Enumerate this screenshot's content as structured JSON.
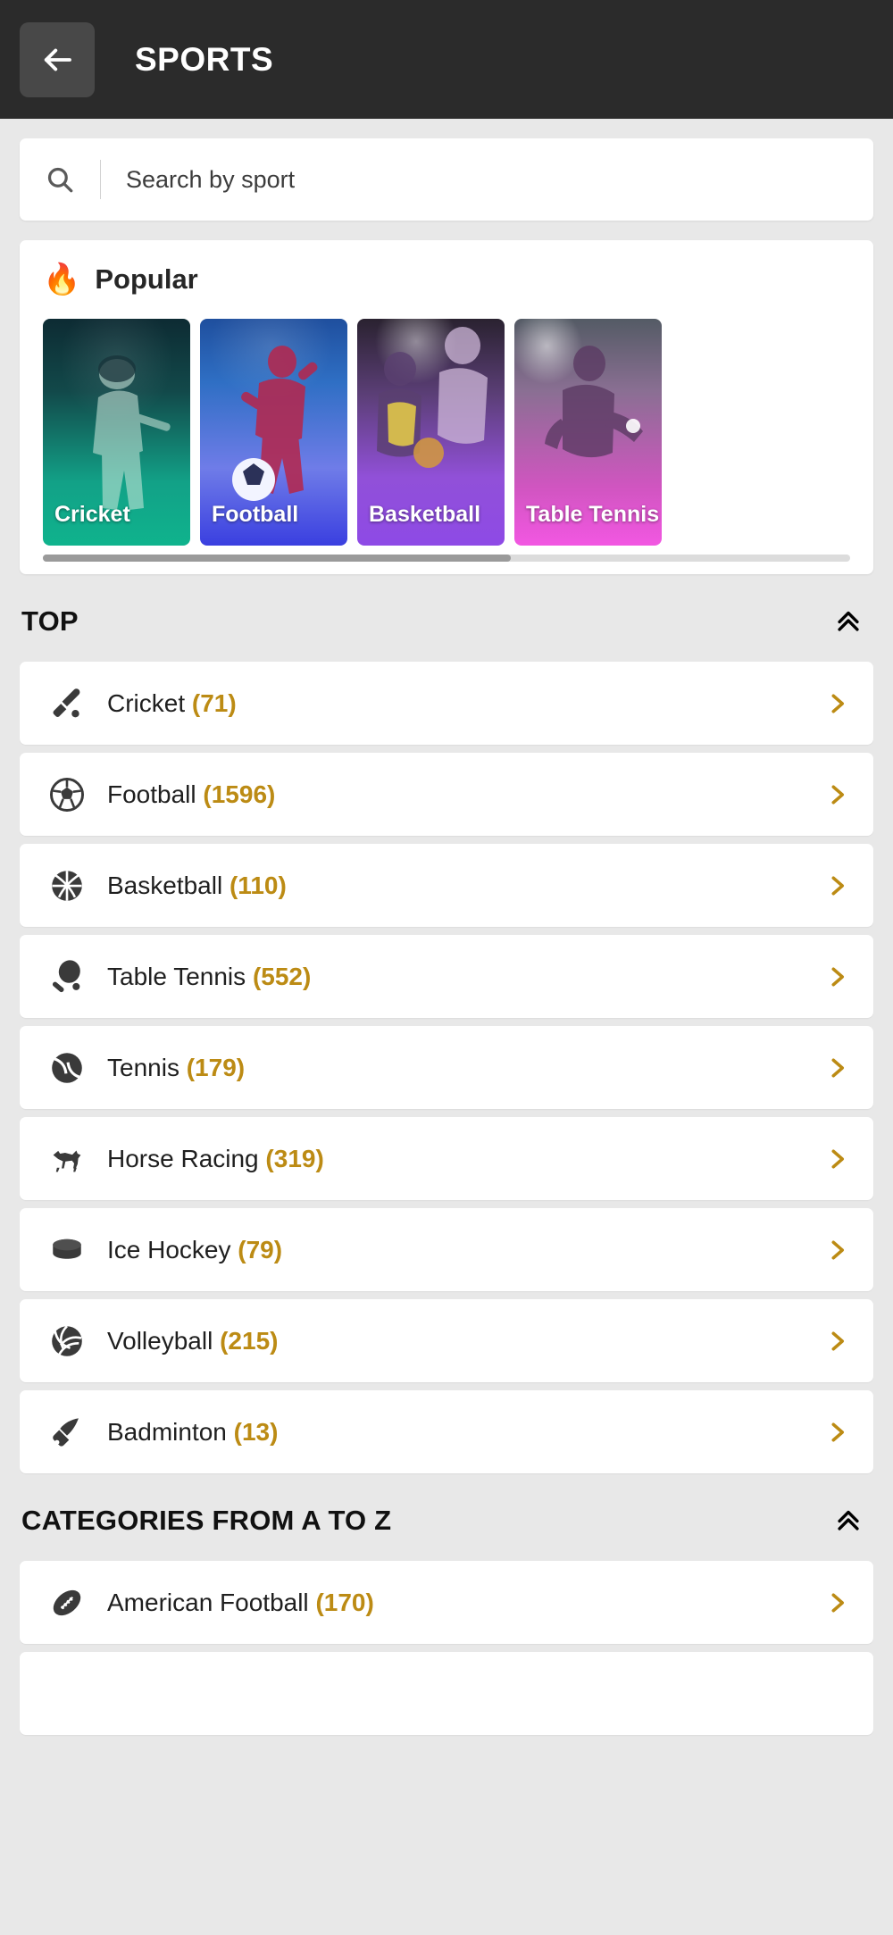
{
  "appbar": {
    "back_icon": "arrow-left-icon",
    "title": "SPORTS"
  },
  "search": {
    "icon": "search-icon",
    "placeholder": "Search by sport",
    "value": ""
  },
  "popular": {
    "icon": "fire-icon",
    "icon_glyph": "🔥",
    "title": "Popular",
    "cards": [
      {
        "label": "Cricket",
        "art": "cricket",
        "accent": "#0fb38d"
      },
      {
        "label": "Football",
        "art": "football",
        "accent": "#3a3fe0"
      },
      {
        "label": "Basketball",
        "art": "basketball",
        "accent": "#8e4ae6"
      },
      {
        "label": "Table Tennis",
        "art": "tabletennis",
        "accent": "#f257e2"
      }
    ]
  },
  "colors": {
    "accent_gold": "#BC8B14",
    "appbar_bg": "#2b2b2b",
    "page_bg": "#e8e8e8",
    "card_bg": "#ffffff",
    "text": "#1f1f1f"
  },
  "sections": [
    {
      "title": "TOP",
      "collapse_icon": "chevron-double-up-icon",
      "items": [
        {
          "name": "Cricket",
          "count": "(71)",
          "icon": "cricket-bat-icon",
          "chevron": "chevron-right-icon"
        },
        {
          "name": "Football",
          "count": "(1596)",
          "icon": "soccer-ball-icon",
          "chevron": "chevron-right-icon"
        },
        {
          "name": "Basketball",
          "count": "(110)",
          "icon": "basketball-icon",
          "chevron": "chevron-right-icon"
        },
        {
          "name": "Table Tennis",
          "count": "(552)",
          "icon": "ping-pong-paddle-icon",
          "chevron": "chevron-right-icon"
        },
        {
          "name": "Tennis",
          "count": "(179)",
          "icon": "tennis-ball-icon",
          "chevron": "chevron-right-icon"
        },
        {
          "name": "Horse Racing",
          "count": "(319)",
          "icon": "horse-icon",
          "chevron": "chevron-right-icon"
        },
        {
          "name": "Ice Hockey",
          "count": "(79)",
          "icon": "hockey-puck-icon",
          "chevron": "chevron-right-icon"
        },
        {
          "name": "Volleyball",
          "count": "(215)",
          "icon": "volleyball-icon",
          "chevron": "chevron-right-icon"
        },
        {
          "name": "Badminton",
          "count": "(13)",
          "icon": "shuttlecock-icon",
          "chevron": "chevron-right-icon"
        }
      ]
    },
    {
      "title": "CATEGORIES FROM A TO Z",
      "collapse_icon": "chevron-double-up-icon",
      "items": [
        {
          "name": "American Football",
          "count": "(170)",
          "icon": "american-football-icon",
          "chevron": "chevron-right-icon"
        }
      ]
    }
  ]
}
